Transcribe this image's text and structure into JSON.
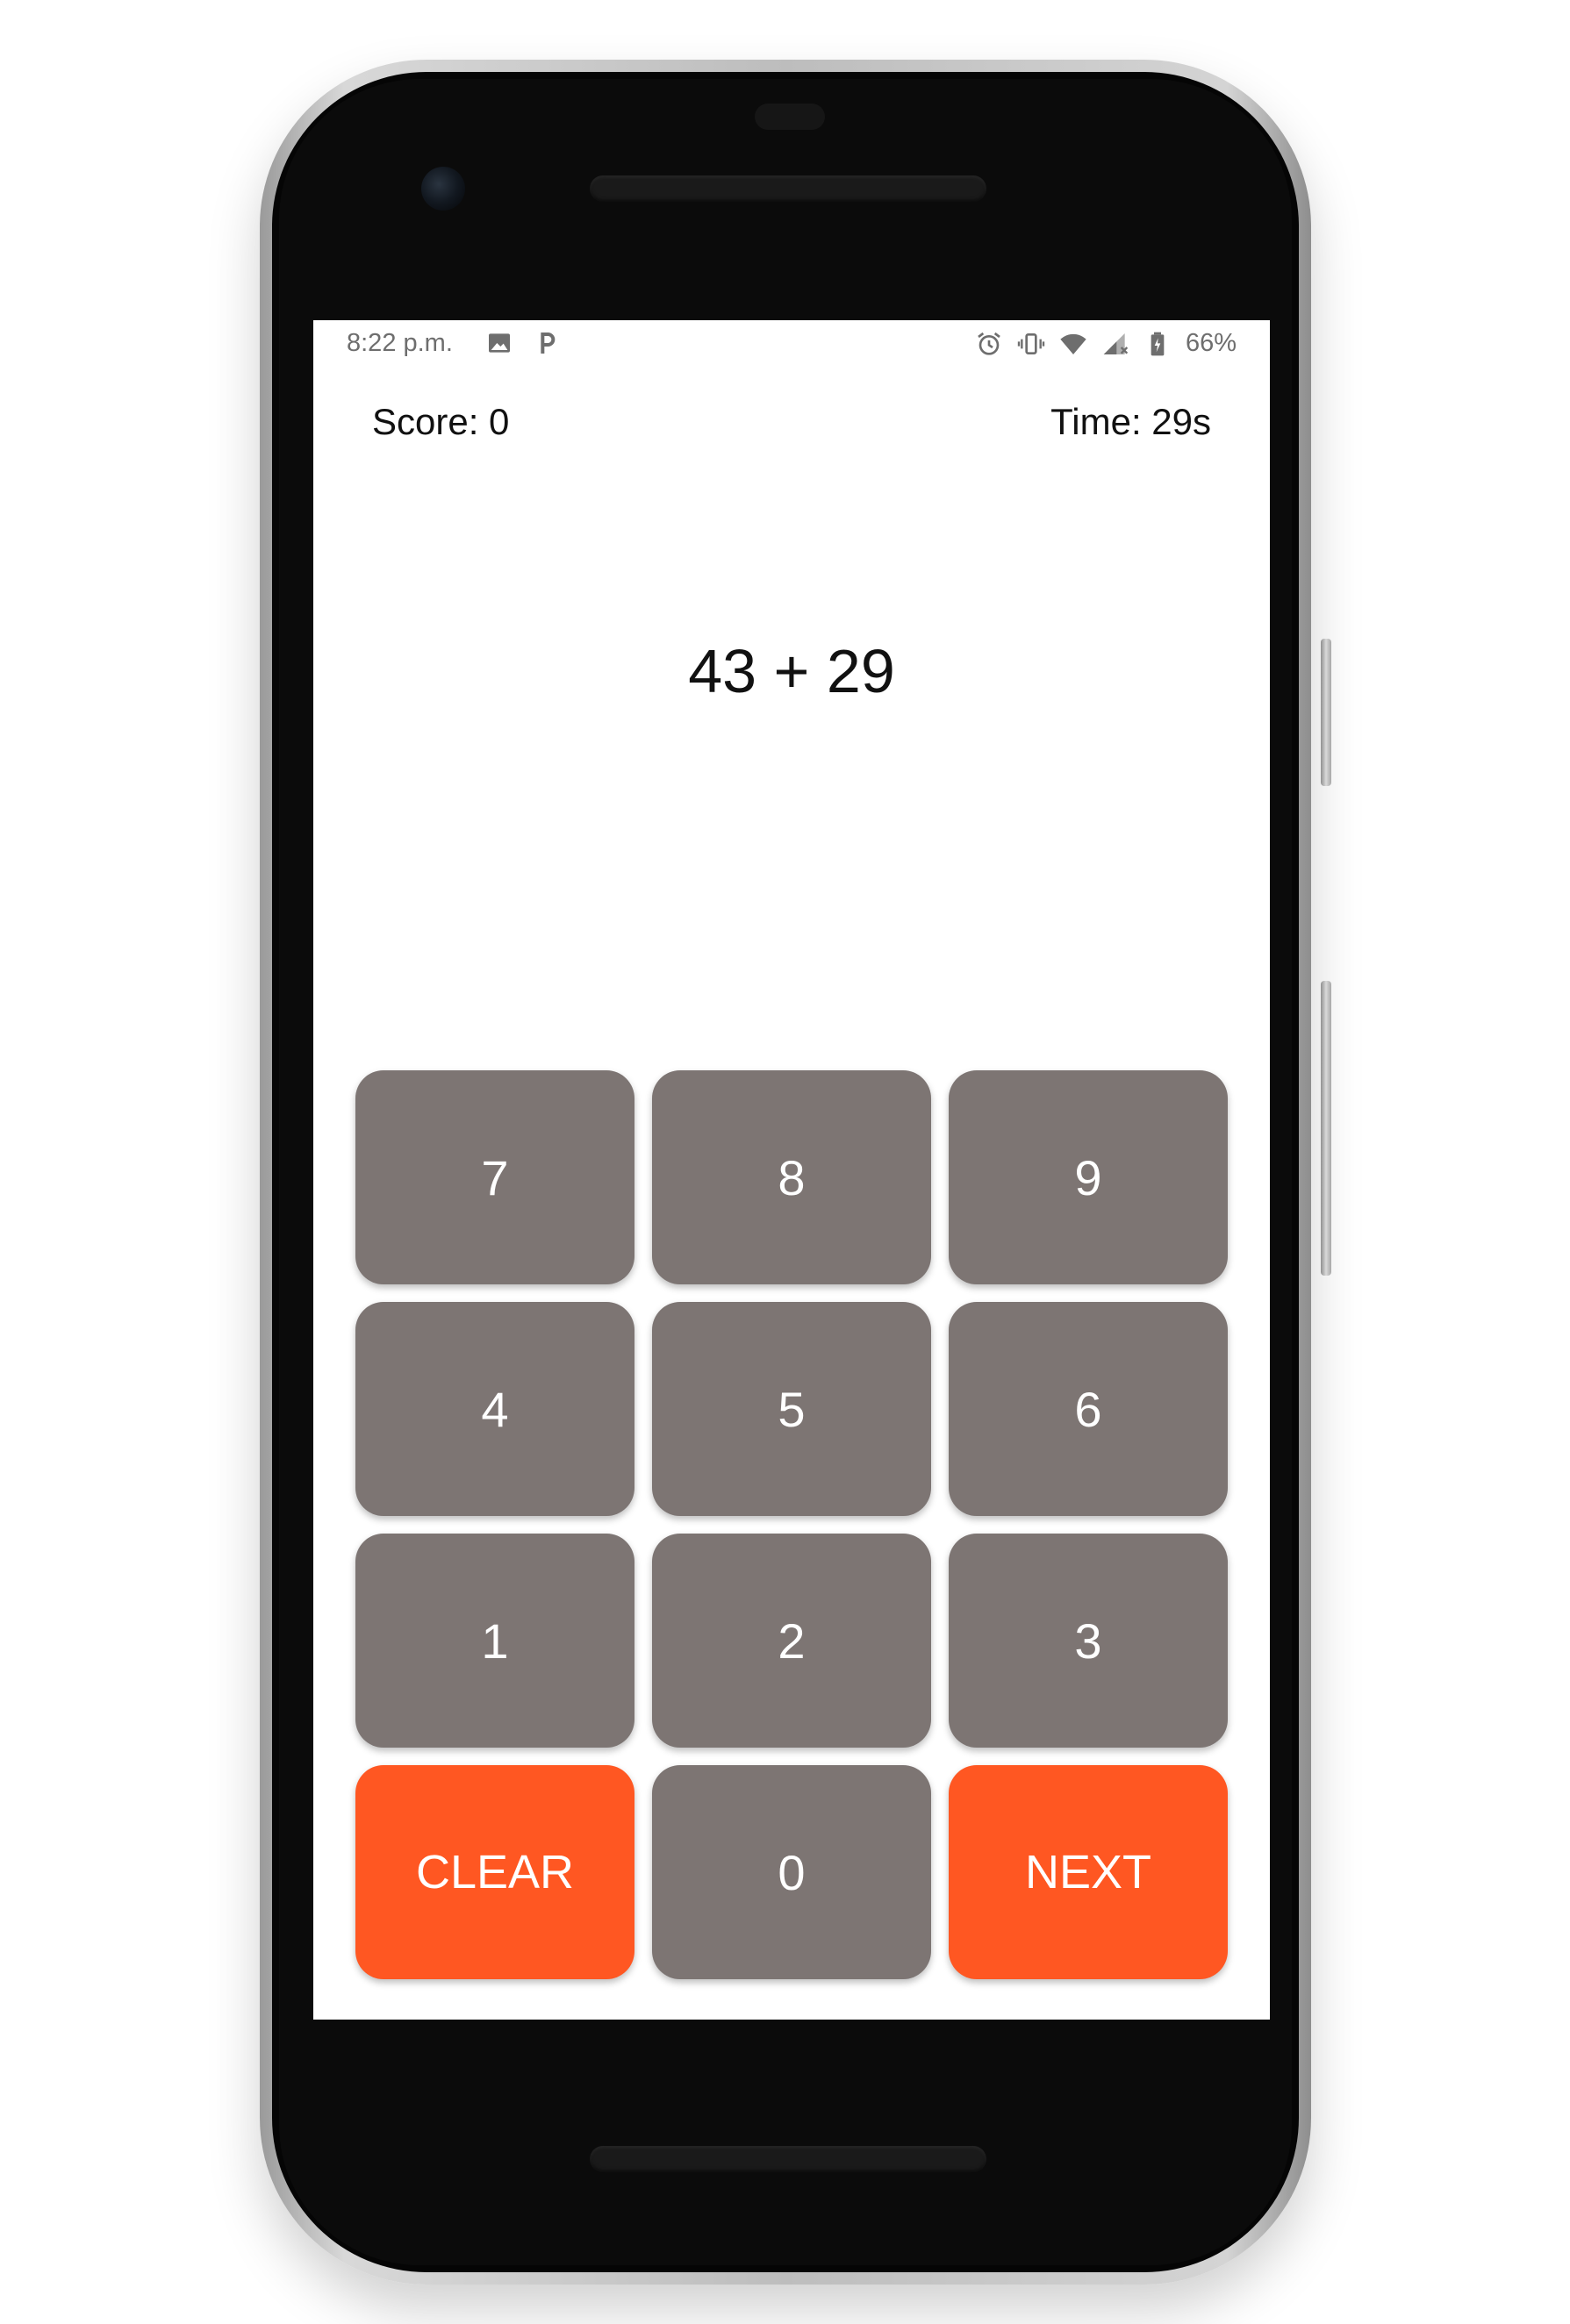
{
  "colors": {
    "key_background": "#7d7573",
    "accent_key_background": "#ff5722",
    "key_text": "#ffffff"
  },
  "status_bar": {
    "time": "8:22 p.m.",
    "left_icons": [
      "image-icon",
      "parking-icon"
    ],
    "right_icons": [
      "alarm-icon",
      "vibrate-icon",
      "wifi-icon",
      "signal-icon",
      "battery-icon"
    ],
    "battery": "66%"
  },
  "game": {
    "score_label": "Score: 0",
    "time_label": "Time: 29s",
    "question": "43 + 29"
  },
  "keypad": {
    "keys": [
      {
        "label": "7",
        "role": "digit"
      },
      {
        "label": "8",
        "role": "digit"
      },
      {
        "label": "9",
        "role": "digit"
      },
      {
        "label": "4",
        "role": "digit"
      },
      {
        "label": "5",
        "role": "digit"
      },
      {
        "label": "6",
        "role": "digit"
      },
      {
        "label": "1",
        "role": "digit"
      },
      {
        "label": "2",
        "role": "digit"
      },
      {
        "label": "3",
        "role": "digit"
      },
      {
        "label": "CLEAR",
        "role": "clear"
      },
      {
        "label": "0",
        "role": "digit"
      },
      {
        "label": "NEXT",
        "role": "next"
      }
    ]
  }
}
